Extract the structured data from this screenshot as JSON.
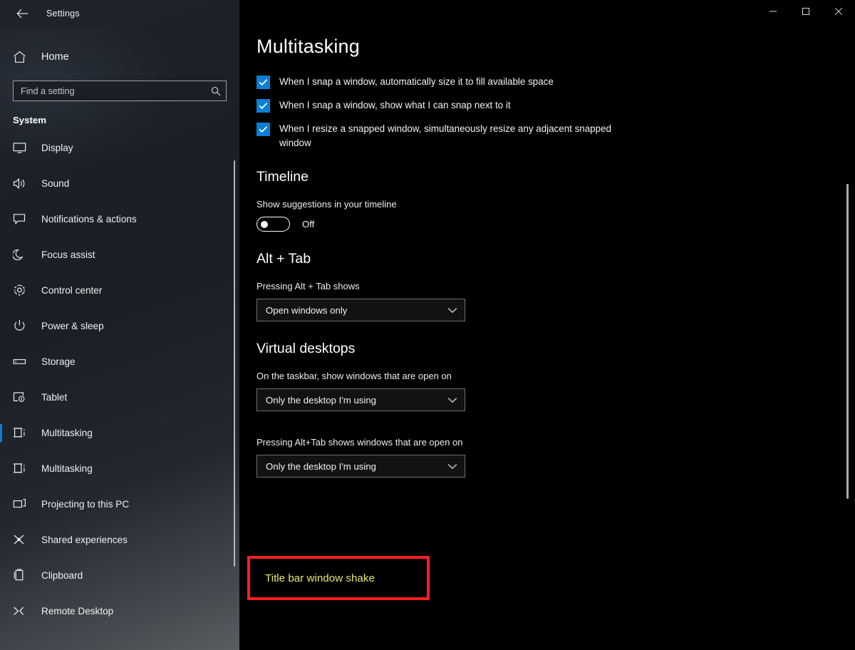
{
  "window": {
    "title": "Settings",
    "back_icon": "back-arrow-icon",
    "controls": {
      "minimize": "minimize-icon",
      "maximize": "maximize-icon",
      "close": "close-icon"
    }
  },
  "sidebar": {
    "home": {
      "label": "Home",
      "icon": "home-icon"
    },
    "search": {
      "placeholder": "Find a setting",
      "value": "",
      "icon": "search-icon"
    },
    "group_header": "System",
    "items": [
      {
        "label": "Display",
        "icon": "monitor-icon",
        "selected": false
      },
      {
        "label": "Sound",
        "icon": "speaker-icon",
        "selected": false
      },
      {
        "label": "Notifications & actions",
        "icon": "notification-icon",
        "selected": false
      },
      {
        "label": "Focus assist",
        "icon": "moon-icon",
        "selected": false
      },
      {
        "label": "Control center",
        "icon": "gear-icon",
        "selected": false
      },
      {
        "label": "Power & sleep",
        "icon": "power-icon",
        "selected": false
      },
      {
        "label": "Storage",
        "icon": "storage-icon",
        "selected": false
      },
      {
        "label": "Tablet",
        "icon": "tablet-icon",
        "selected": false
      },
      {
        "label": "Multitasking",
        "icon": "multitasking-icon",
        "selected": true
      },
      {
        "label": "Multitasking",
        "icon": "multitasking-icon",
        "selected": false
      },
      {
        "label": "Projecting to this PC",
        "icon": "project-screen-icon",
        "selected": false
      },
      {
        "label": "Shared experiences",
        "icon": "share-icon",
        "selected": false
      },
      {
        "label": "Clipboard",
        "icon": "clipboard-icon",
        "selected": false
      },
      {
        "label": "Remote Desktop",
        "icon": "remote-desktop-icon",
        "selected": false
      }
    ]
  },
  "main": {
    "page_title": "Multitasking",
    "snap_checkboxes": [
      {
        "label": "When I snap a window, automatically size it to fill available space",
        "checked": true
      },
      {
        "label": "When I snap a window, show what I can snap next to it",
        "checked": true
      },
      {
        "label": "When I resize a snapped window, simultaneously resize any adjacent snapped window",
        "checked": true
      }
    ],
    "timeline": {
      "title": "Timeline",
      "toggle_label": "Show suggestions in your timeline",
      "toggle_state": "Off",
      "toggle_on": false
    },
    "alt_tab": {
      "title": "Alt + Tab",
      "field_label": "Pressing Alt + Tab shows",
      "value": "Open windows only",
      "chevron": "chevron-down-icon"
    },
    "virtual_desktops": {
      "title": "Virtual desktops",
      "taskbar_label": "On the taskbar, show windows that are open on",
      "taskbar_value": "Only the desktop I'm using",
      "alttab_label": "Pressing Alt+Tab shows windows that are open on",
      "alttab_value": "Only the desktop I'm using"
    },
    "highlight": {
      "text": "Title bar window shake",
      "border_color": "#fc1f1f",
      "text_color": "#e9e96a"
    }
  },
  "colors": {
    "accent": "#0a7fd4",
    "background": "#000000",
    "sidebar_top": "#1f242c"
  }
}
